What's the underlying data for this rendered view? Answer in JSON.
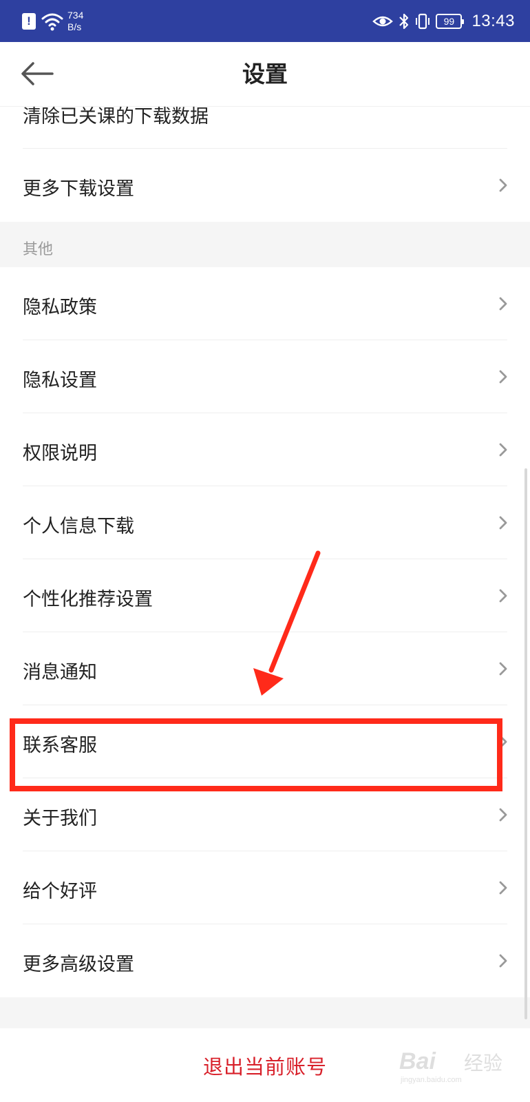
{
  "status_bar": {
    "network_speed_value": "734",
    "network_speed_unit": "B/s",
    "battery": "99",
    "time": "13:43",
    "alert_icon": "alert-icon",
    "wifi_icon": "wifi-icon",
    "eye_icon": "eye-icon",
    "bluetooth_icon": "bluetooth-icon",
    "vibrate_icon": "vibrate-icon",
    "color": "#2e40a0"
  },
  "header": {
    "title": "设置",
    "back_icon": "back-arrow-icon"
  },
  "download_section": {
    "items": [
      {
        "label": "清除已关课的下载数据"
      },
      {
        "label": "更多下载设置"
      }
    ]
  },
  "other_section": {
    "title": "其他",
    "items": [
      {
        "label": "隐私政策"
      },
      {
        "label": "隐私设置"
      },
      {
        "label": "权限说明"
      },
      {
        "label": "个人信息下载"
      },
      {
        "label": "个性化推荐设置"
      },
      {
        "label": "消息通知"
      },
      {
        "label": "联系客服"
      },
      {
        "label": "关于我们"
      },
      {
        "label": "给个好评"
      },
      {
        "label": "更多高级设置"
      }
    ]
  },
  "logout": {
    "label": "退出当前账号",
    "color": "#d8202a"
  },
  "annotation": {
    "highlight_color": "#ff2a1a",
    "highlighted_item": "联系客服"
  },
  "watermark": {
    "brand": "Bai",
    "brand_suffix": "经验",
    "url": "jingyan.baidu.com"
  }
}
